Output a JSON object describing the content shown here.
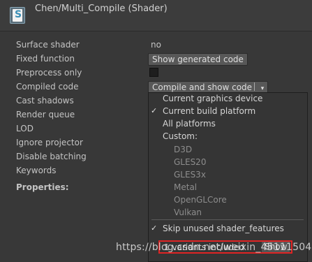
{
  "header": {
    "icon_letter": "S",
    "title": "Chen/Multi_Compile (Shader)"
  },
  "inspector": {
    "surface_shader": {
      "label": "Surface shader",
      "value": "no"
    },
    "fixed_function": {
      "label": "Fixed function",
      "button": "Show generated code"
    },
    "preprocess_only": {
      "label": "Preprocess only",
      "checked": false
    },
    "compiled_code": {
      "label": "Compiled code",
      "button": "Compile and show code",
      "arrow": "▾"
    },
    "cast_shadows": {
      "label": "Cast shadows"
    },
    "render_queue": {
      "label": "Render queue"
    },
    "lod": {
      "label": "LOD"
    },
    "ignore_projector": {
      "label": "Ignore projector"
    },
    "disable_batching": {
      "label": "Disable batching"
    },
    "keywords": {
      "label": "Keywords"
    },
    "properties": {
      "label": "Properties:"
    }
  },
  "dropdown": {
    "items": [
      {
        "label": "Current graphics device",
        "checked": false,
        "enabled": true
      },
      {
        "label": "Current build platform",
        "checked": true,
        "enabled": true
      },
      {
        "label": "All platforms",
        "checked": false,
        "enabled": true
      },
      {
        "label": "Custom:",
        "checked": false,
        "enabled": true
      },
      {
        "label": "D3D",
        "checked": false,
        "enabled": false
      },
      {
        "label": "GLES20",
        "checked": false,
        "enabled": false
      },
      {
        "label": "GLES3x",
        "checked": false,
        "enabled": false
      },
      {
        "label": "Metal",
        "checked": false,
        "enabled": false
      },
      {
        "label": "OpenGLCore",
        "checked": false,
        "enabled": false
      },
      {
        "label": "Vulkan",
        "checked": false,
        "enabled": false
      }
    ],
    "skip_unused": {
      "label": "Skip unused shader_features",
      "checked": true
    },
    "variants": {
      "label": "1 variants included",
      "button": "Show"
    },
    "check_glyph": "✓"
  },
  "watermark": "https://blog.csdn.net/weixin_45111504",
  "colors": {
    "background": "#383838",
    "highlight_border": "#e02424"
  }
}
